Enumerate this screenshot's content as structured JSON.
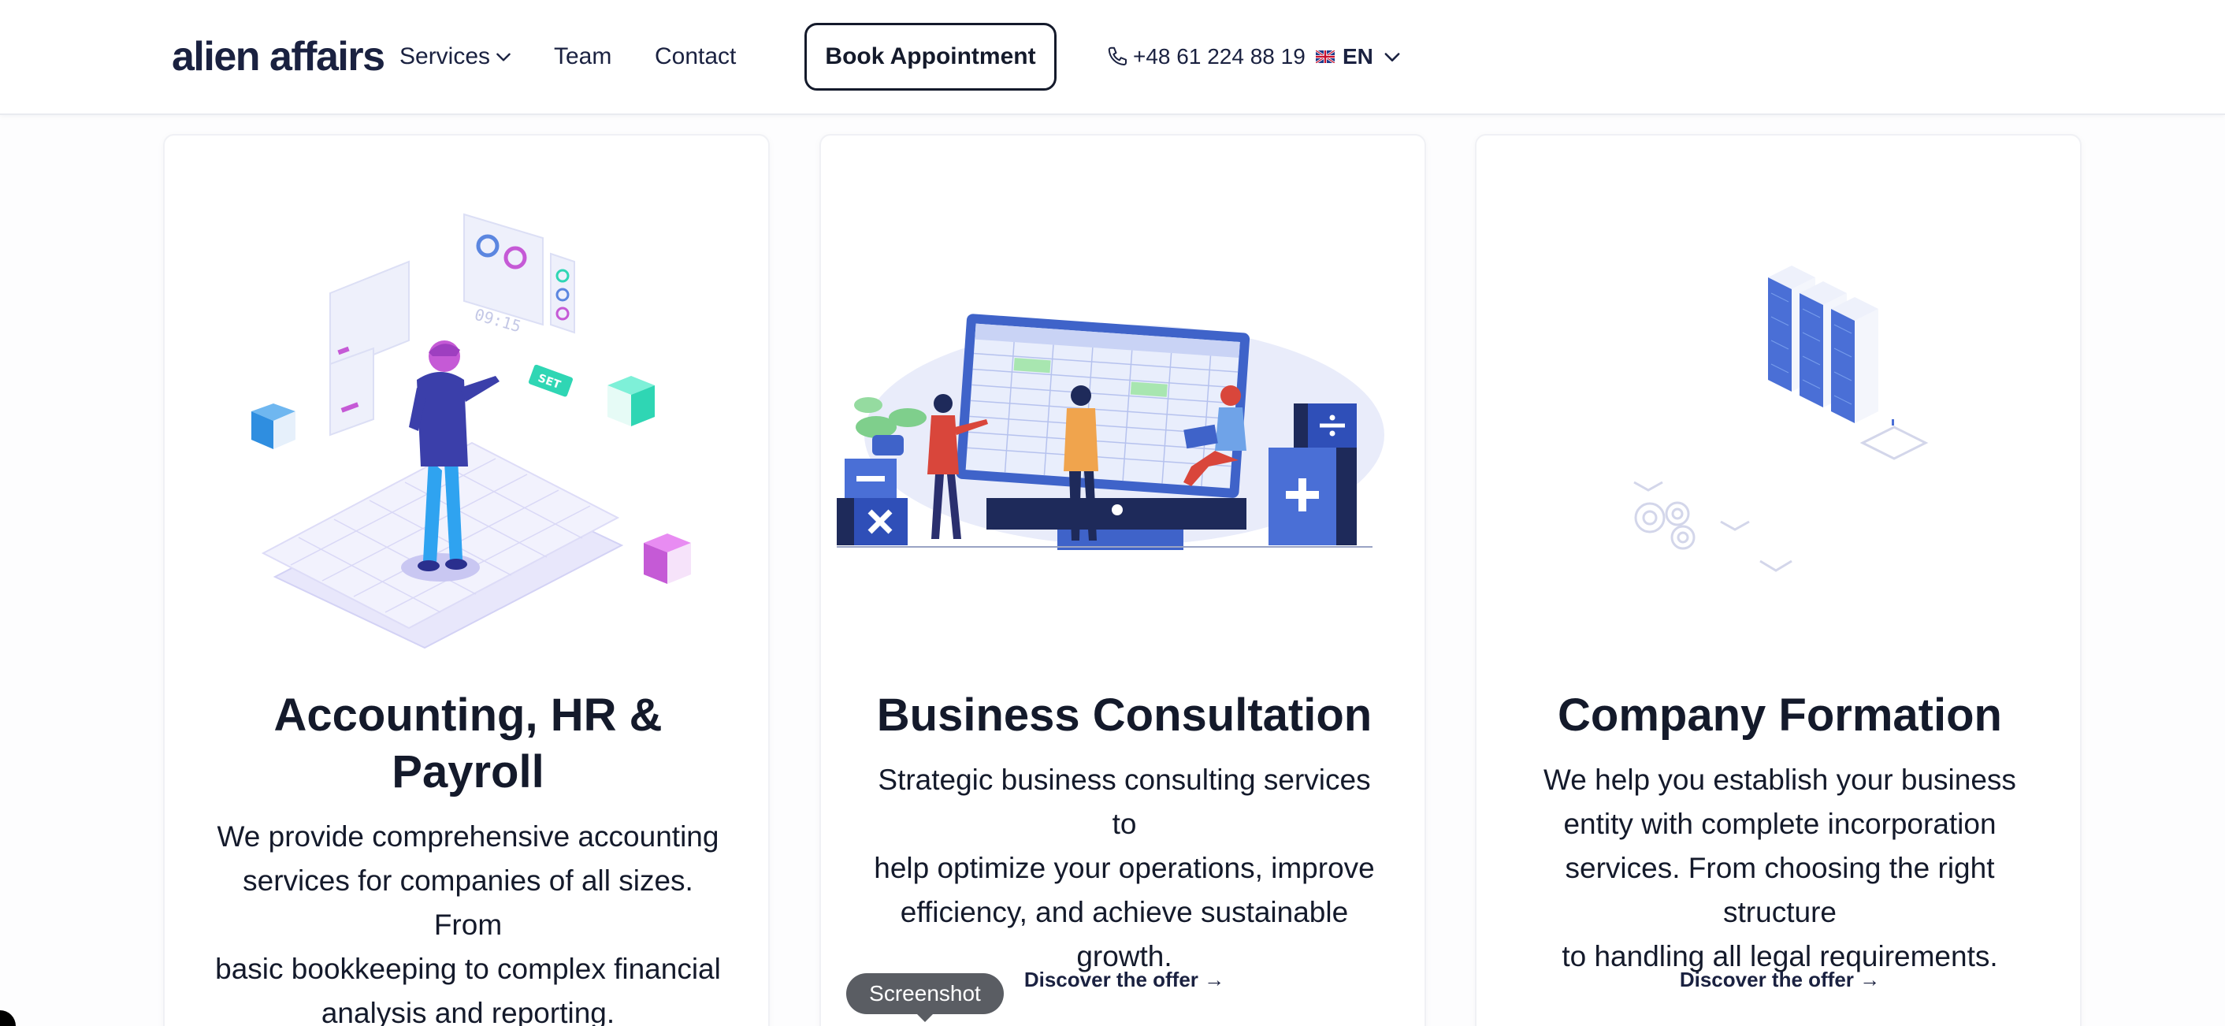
{
  "header": {
    "logo": "alien affairs",
    "nav": {
      "services": "Services",
      "team": "Team",
      "contact": "Contact"
    },
    "book_button": "Book Appointment",
    "phone": "+48 61 224 88 19",
    "language": "EN"
  },
  "cards": [
    {
      "title_line1": "Accounting, HR &",
      "title_line2": "Payroll",
      "desc": [
        "We provide comprehensive accounting",
        "services for companies of all sizes. From",
        "basic bookkeeping to complex financial",
        "analysis and reporting."
      ]
    },
    {
      "title": "Business Consultation",
      "desc": [
        "Strategic business consulting services to",
        "help optimize your operations, improve",
        "efficiency, and achieve sustainable",
        "growth."
      ],
      "link": "Discover the offer →"
    },
    {
      "title": "Company Formation",
      "desc": [
        "We help you establish your business",
        "entity with complete incorporation",
        "services. From choosing the right structure",
        "to handling all legal requirements."
      ],
      "link": "Discover the offer →"
    }
  ],
  "illustration_text": {
    "time": "09:15",
    "set": "SET"
  },
  "tooltip": "Screenshot",
  "colors": {
    "primary": "#141a2b",
    "accent_blue": "#4a6fd6",
    "teal": "#2fd6b4",
    "pink": "#c55ad6"
  }
}
